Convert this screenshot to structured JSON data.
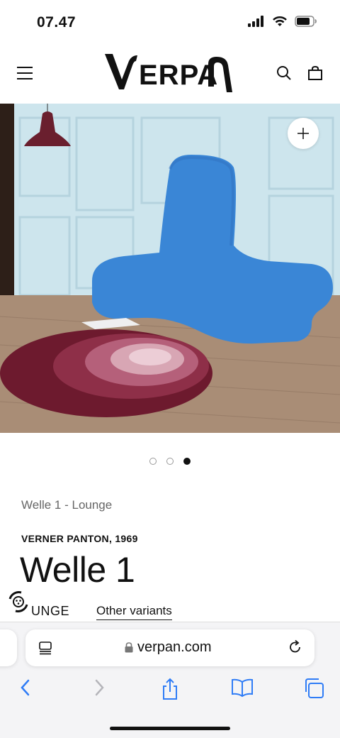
{
  "status_bar": {
    "time": "07.47"
  },
  "header": {
    "logo_text": "VERPAN"
  },
  "hero": {
    "image_alt": "Blue Welle 1 lounge chair in room with round rug and pendant lamp"
  },
  "carousel": {
    "count": 3,
    "active_index": 2
  },
  "product": {
    "breadcrumb": "Welle 1 - Lounge",
    "designer": "VERNER PANTON, 1969",
    "title": "Welle 1",
    "category": "UNGE",
    "other_variants": "Other variants"
  },
  "browser": {
    "url": "verpan.com"
  },
  "colors": {
    "chair_blue": "#3a86d6",
    "wall": "#cfe6ee",
    "floor": "#a78b74",
    "rug_dark": "#6d1a2e",
    "link_blue": "#2f7cf6"
  }
}
